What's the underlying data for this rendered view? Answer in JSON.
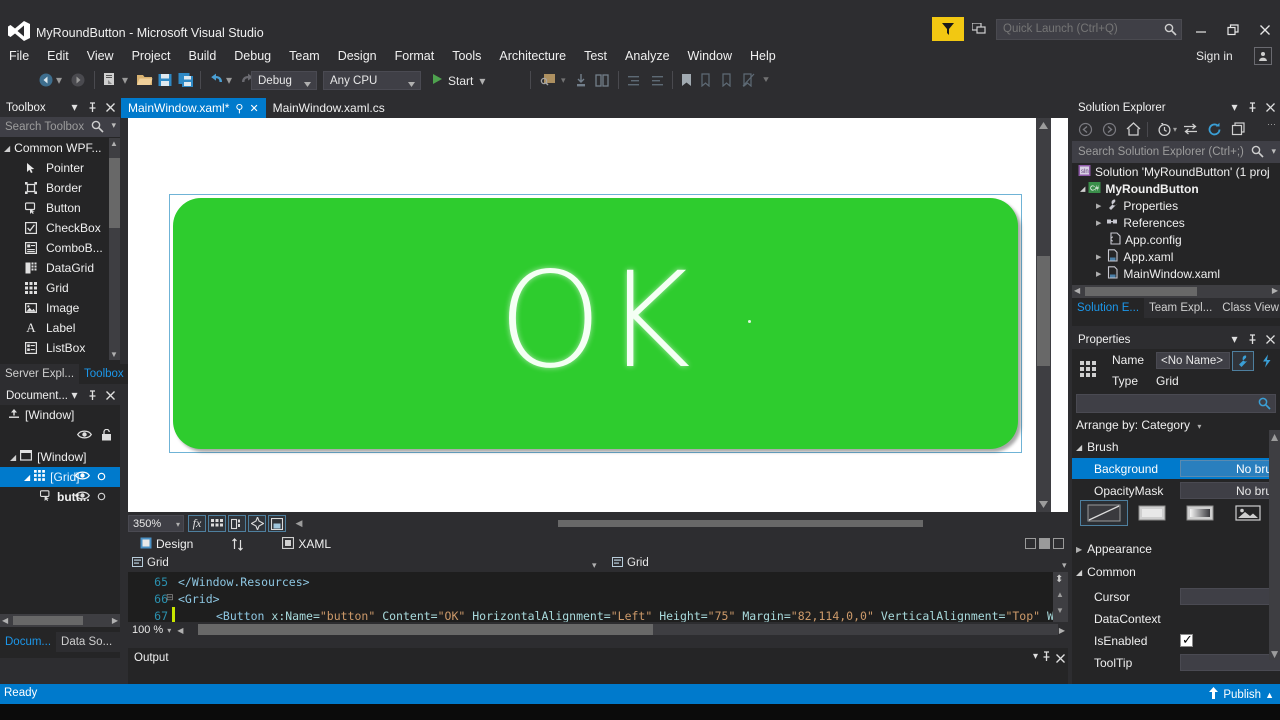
{
  "window": {
    "title": "MyRoundButton - Microsoft Visual Studio",
    "logo_icon": "visual-studio-logo",
    "minimize_icon": "minimize-icon",
    "maximize_icon": "restore-icon",
    "close_icon": "close-icon",
    "sign_in_label": "Sign in",
    "feedback_icon": "feedback-funnel-icon",
    "notifications_icon": "notifications-icon",
    "account_icon": "account-icon"
  },
  "quick_launch": {
    "placeholder": "Quick Launch (Ctrl+Q)",
    "value": "",
    "search_icon": "search-icon"
  },
  "menu": {
    "items": [
      {
        "label": "File"
      },
      {
        "label": "Edit"
      },
      {
        "label": "View"
      },
      {
        "label": "Project"
      },
      {
        "label": "Build"
      },
      {
        "label": "Debug"
      },
      {
        "label": "Team"
      },
      {
        "label": "Design"
      },
      {
        "label": "Format"
      },
      {
        "label": "Tools"
      },
      {
        "label": "Architecture"
      },
      {
        "label": "Test"
      },
      {
        "label": "Analyze"
      },
      {
        "label": "Window"
      },
      {
        "label": "Help"
      }
    ]
  },
  "toolbar": {
    "config_combo": "Debug",
    "platform_combo": "Any CPU",
    "start_label": "Start",
    "back_icon": "navigate-back-icon",
    "forward_icon": "navigate-forward-icon",
    "new_project_icon": "new-project-icon",
    "open_file_icon": "open-file-icon",
    "save_icon": "save-icon",
    "save_all_icon": "save-all-icon",
    "undo_icon": "undo-icon",
    "redo_icon": "redo-icon",
    "start_icon": "start-debug-play-icon",
    "overflow_icon": "toolbar-overflow-icon"
  },
  "toolbox": {
    "title": "Toolbox",
    "search_placeholder": "Search Toolbox",
    "search_icon": "search-icon",
    "dropdown_icon": "chevron-down-icon",
    "pin_icon": "pin-icon",
    "close_icon": "close-icon",
    "group": "Common WPF...",
    "items": [
      {
        "label": "Pointer",
        "icon": "pointer-icon"
      },
      {
        "label": "Border",
        "icon": "border-icon"
      },
      {
        "label": "Button",
        "icon": "button-icon"
      },
      {
        "label": "CheckBox",
        "icon": "checkbox-icon"
      },
      {
        "label": "ComboB...",
        "icon": "combobox-icon"
      },
      {
        "label": "DataGrid",
        "icon": "datagrid-icon"
      },
      {
        "label": "Grid",
        "icon": "grid-icon"
      },
      {
        "label": "Image",
        "icon": "image-icon"
      },
      {
        "label": "Label",
        "icon": "label-icon"
      },
      {
        "label": "ListBox",
        "icon": "listbox-icon"
      }
    ],
    "tabs": [
      {
        "label": "Server Expl...",
        "active": false
      },
      {
        "label": "Toolbox",
        "active": true
      }
    ]
  },
  "document_outline": {
    "title": "Document...",
    "pin_icon": "pin-icon",
    "close_icon": "close-icon",
    "dropdown_icon": "chevron-down-icon",
    "root_label": "[Window]",
    "root_icon": "upload-root-icon",
    "eye_icon": "eye-icon",
    "lock_icon": "lock-icon",
    "tree": [
      {
        "label": "[Window]",
        "icon": "window-icon",
        "indent": 10,
        "selected": false,
        "eye": false,
        "circle": false
      },
      {
        "label": "[Grid]",
        "icon": "grid-icon",
        "indent": 24,
        "selected": true,
        "eye": true,
        "circle": true
      },
      {
        "label": "butt...",
        "icon": "button-icon",
        "indent": 40,
        "selected": false,
        "eye": true,
        "circle": true
      }
    ],
    "tabs": [
      {
        "label": "Docum...",
        "active": true
      },
      {
        "label": "Data So...",
        "active": false
      }
    ]
  },
  "document_tabs": [
    {
      "label": "MainWindow.xaml*",
      "active": true,
      "pin_icon": "pin-icon",
      "close_icon": "close-icon"
    },
    {
      "label": "MainWindow.xaml.cs",
      "active": false
    }
  ],
  "designer": {
    "button": {
      "text": "OK",
      "fill_color": "#2ecc2e",
      "text_color": "#f4fff4",
      "selection_color": "#6fb3d6"
    },
    "zoom": "350%",
    "zoom_dropdown_icon": "chevron-down-icon",
    "effects_icon": "fx-icon",
    "grid_icon": "snap-grid-icon",
    "align_icon": "align-icon",
    "snap_icon": "snap-to-icon",
    "artboard_icon": "artboard-icon",
    "collapse_icon": "collapse-left-icon",
    "tabs": [
      {
        "label": "Design",
        "icon": "design-view-icon",
        "active": true
      },
      {
        "label": "XAML",
        "icon": "xaml-view-icon",
        "active": false
      }
    ],
    "swap_icon": "swap-panes-icon",
    "split_icons": [
      "split-vertical-icon",
      "split-horizontal-icon",
      "split-tabs-icon"
    ]
  },
  "xaml_editor": {
    "breadcrumb_left": "Grid",
    "breadcrumb_right": "Grid",
    "breadcrumb_icon": "element-icon",
    "zoom": "100 %",
    "lines": [
      {
        "number": "65",
        "text": "</Window.Resources>"
      },
      {
        "number": "66",
        "text": "<Grid>"
      },
      {
        "number": "67",
        "text": "<Button x:Name=\"button\" Content=\"OK\" HorizontalAlignment=\"Left\" Height=\"75\" Margin=\"82,114,0,0\" VerticalAlignment=\"Top\" Wi"
      }
    ],
    "code_tokens": {
      "l65": "</Window.Resources>",
      "l66": "<Grid>",
      "l67_tag": "<Button",
      "l67_a1": "x:Name=",
      "l67_v1": "\"button\"",
      "l67_a2": "Content=",
      "l67_v2": "\"OK\"",
      "l67_a3": "HorizontalAlignment=",
      "l67_v3": "\"Left\"",
      "l67_a4": "Height=",
      "l67_v4": "\"75\"",
      "l67_a5": "Margin=",
      "l67_v5": "\"82,114,0,0\"",
      "l67_a6": "VerticalAlignment=",
      "l67_v6": "\"Top\"",
      "l67_a7": "Wi"
    }
  },
  "output": {
    "title": "Output",
    "dropdown_icon": "chevron-down-icon",
    "pin_icon": "pin-icon",
    "close_icon": "close-icon"
  },
  "solution_explorer": {
    "title": "Solution Explorer",
    "dropdown_icon": "chevron-down-icon",
    "pin_icon": "pin-icon",
    "close_icon": "close-icon",
    "search_placeholder": "Search Solution Explorer (Ctrl+;)",
    "search_icon": "search-icon",
    "toolbar_icons": [
      "back-icon",
      "forward-icon",
      "home-icon",
      "pending-changes-icon",
      "sync-with-active-document-icon",
      "refresh-icon",
      "show-all-files-icon",
      "overflow-icon"
    ],
    "tree": [
      {
        "label": "Solution 'MyRoundButton' (1 proj",
        "icon": "solution-icon",
        "indent": 14,
        "expander": ""
      },
      {
        "label": "MyRoundButton",
        "icon": "csharp-project-icon",
        "indent": 26,
        "expander": "expanded"
      },
      {
        "label": "Properties",
        "icon": "properties-wrench-icon",
        "indent": 42,
        "expander": "collapsed"
      },
      {
        "label": "References",
        "icon": "references-icon",
        "indent": 42,
        "expander": "collapsed"
      },
      {
        "label": "App.config",
        "icon": "config-file-icon",
        "indent": 54,
        "expander": ""
      },
      {
        "label": "App.xaml",
        "icon": "xaml-file-icon",
        "indent": 42,
        "expander": "collapsed"
      },
      {
        "label": "MainWindow.xaml",
        "icon": "xaml-file-icon",
        "indent": 42,
        "expander": "collapsed"
      }
    ],
    "tabs": [
      {
        "label": "Solution E...",
        "active": true
      },
      {
        "label": "Team Expl...",
        "active": false
      },
      {
        "label": "Class View",
        "active": false
      }
    ]
  },
  "properties": {
    "title": "Properties",
    "dropdown_icon": "chevron-down-icon",
    "pin_icon": "pin-icon",
    "close_icon": "close-icon",
    "element_icon": "grid-element-icon",
    "name_label": "Name",
    "name_value": "<No Name>",
    "type_label": "Type",
    "type_value": "Grid",
    "properties_view_icon": "wrench-properties-icon",
    "events_view_icon": "lightning-events-icon",
    "search_placeholder": "",
    "search_icon": "search-icon",
    "arrange_by": "Arrange by: Category",
    "arrange_icon": "chevron-down-icon",
    "categories": [
      {
        "name": "Brush",
        "expanded": true,
        "rows": [
          {
            "key": "Background",
            "value": "No brus",
            "selected": true
          },
          {
            "key": "OpacityMask",
            "value": "No brus",
            "selected": false
          }
        ]
      },
      {
        "name": "Appearance",
        "expanded": false,
        "rows": []
      },
      {
        "name": "Common",
        "expanded": true,
        "rows": [
          {
            "key": "Cursor",
            "value": "",
            "selected": false
          },
          {
            "key": "DataContext",
            "value": "",
            "selected": false
          },
          {
            "key": "IsEnabled",
            "value": "",
            "selected": false,
            "checkbox": true
          },
          {
            "key": "ToolTip",
            "value": "",
            "selected": false
          }
        ]
      }
    ],
    "brush_buttons": [
      {
        "icon": "no-brush-icon",
        "selected": true
      },
      {
        "icon": "solid-color-brush-icon",
        "selected": false
      },
      {
        "icon": "gradient-brush-icon",
        "selected": false
      },
      {
        "icon": "tile-brush-icon",
        "selected": false
      }
    ]
  },
  "status_bar": {
    "text": "Ready",
    "publish_label": "Publish",
    "publish_icon": "publish-up-arrow-icon",
    "chevron_icon": "chevron-up-icon",
    "background": "#007acc"
  }
}
